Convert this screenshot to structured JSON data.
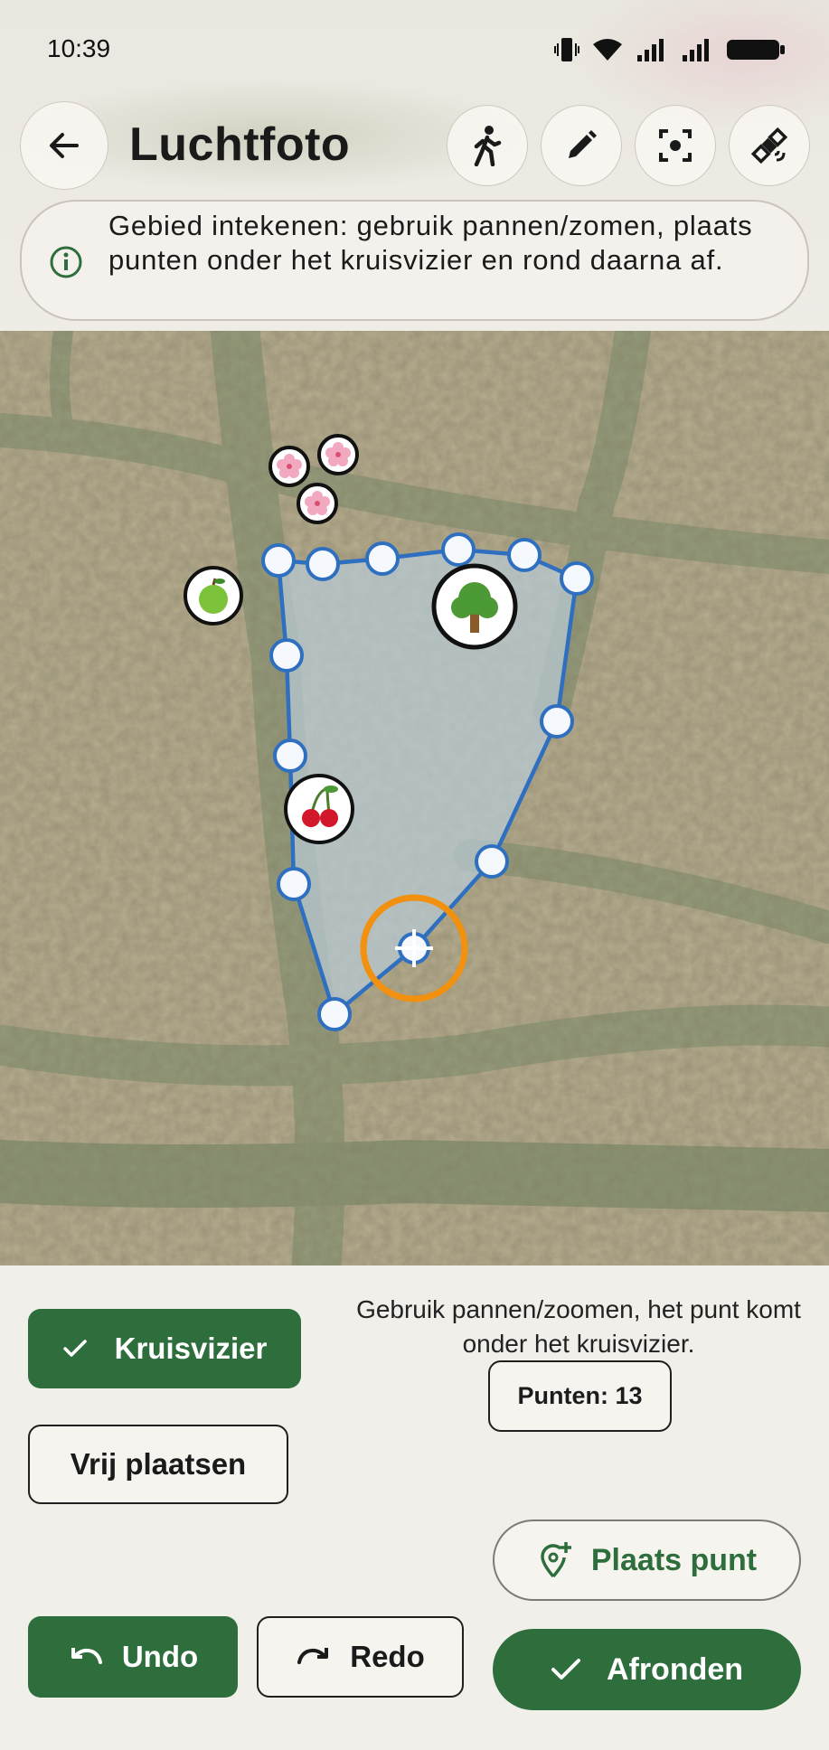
{
  "status_bar": {
    "time": "10:39"
  },
  "header": {
    "title": "Luchtfoto"
  },
  "toolbar_icons": [
    "walk-icon",
    "pencil-icon",
    "focus-icon",
    "satellite-icon"
  ],
  "info_banner": {
    "text": "Gebied intekenen: gebruik pannen/zomen, plaats punten onder het kruisvizier en rond daarna af."
  },
  "map": {
    "markers": [
      "cherry-blossom",
      "cherry-blossom",
      "cherry-blossom",
      "green-apple",
      "tree",
      "cherries"
    ],
    "polygon_color": "#2f6fc0",
    "crosshair_color": "#f2900f"
  },
  "controls": {
    "mode_crosshair": "Kruisvizier",
    "mode_free": "Vrij plaatsen",
    "helper": "Gebruik pannen/zoomen, het punt komt onder het kruisvizier.",
    "points": "Punten: 13",
    "place_point": "Plaats punt",
    "undo": "Undo",
    "redo": "Redo",
    "finish": "Afronden"
  },
  "colors": {
    "primary": "#2e6e3d",
    "background": "#efece6"
  }
}
